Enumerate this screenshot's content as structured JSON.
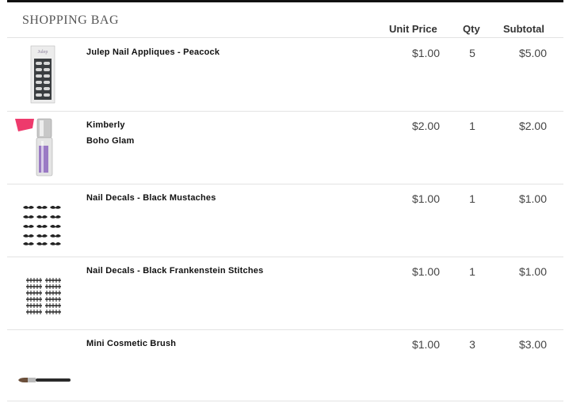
{
  "bag": {
    "title": "SHOPPING BAG",
    "columns": {
      "unit_price": "Unit Price",
      "qty": "Qty",
      "subtotal": "Subtotal"
    }
  },
  "items": [
    {
      "name": "Julep Nail Appliques - Peacock",
      "subname": "",
      "price": "$1.00",
      "qty": "5",
      "subtotal": "$5.00",
      "image": "nail-appliques-card-icon"
    },
    {
      "name": "Kimberly",
      "subname": "Boho Glam",
      "price": "$2.00",
      "qty": "1",
      "subtotal": "$2.00",
      "image": "nail-polish-bottle-icon"
    },
    {
      "name": "Nail Decals - Black Mustaches",
      "subname": "",
      "price": "$1.00",
      "qty": "1",
      "subtotal": "$1.00",
      "image": "mustache-decals-icon"
    },
    {
      "name": "Nail Decals - Black Frankenstein Stitches",
      "subname": "",
      "price": "$1.00",
      "qty": "1",
      "subtotal": "$1.00",
      "image": "stitch-decals-icon"
    },
    {
      "name": "Mini Cosmetic Brush",
      "subname": "",
      "price": "$1.00",
      "qty": "3",
      "subtotal": "$3.00",
      "image": "cosmetic-brush-icon"
    }
  ]
}
